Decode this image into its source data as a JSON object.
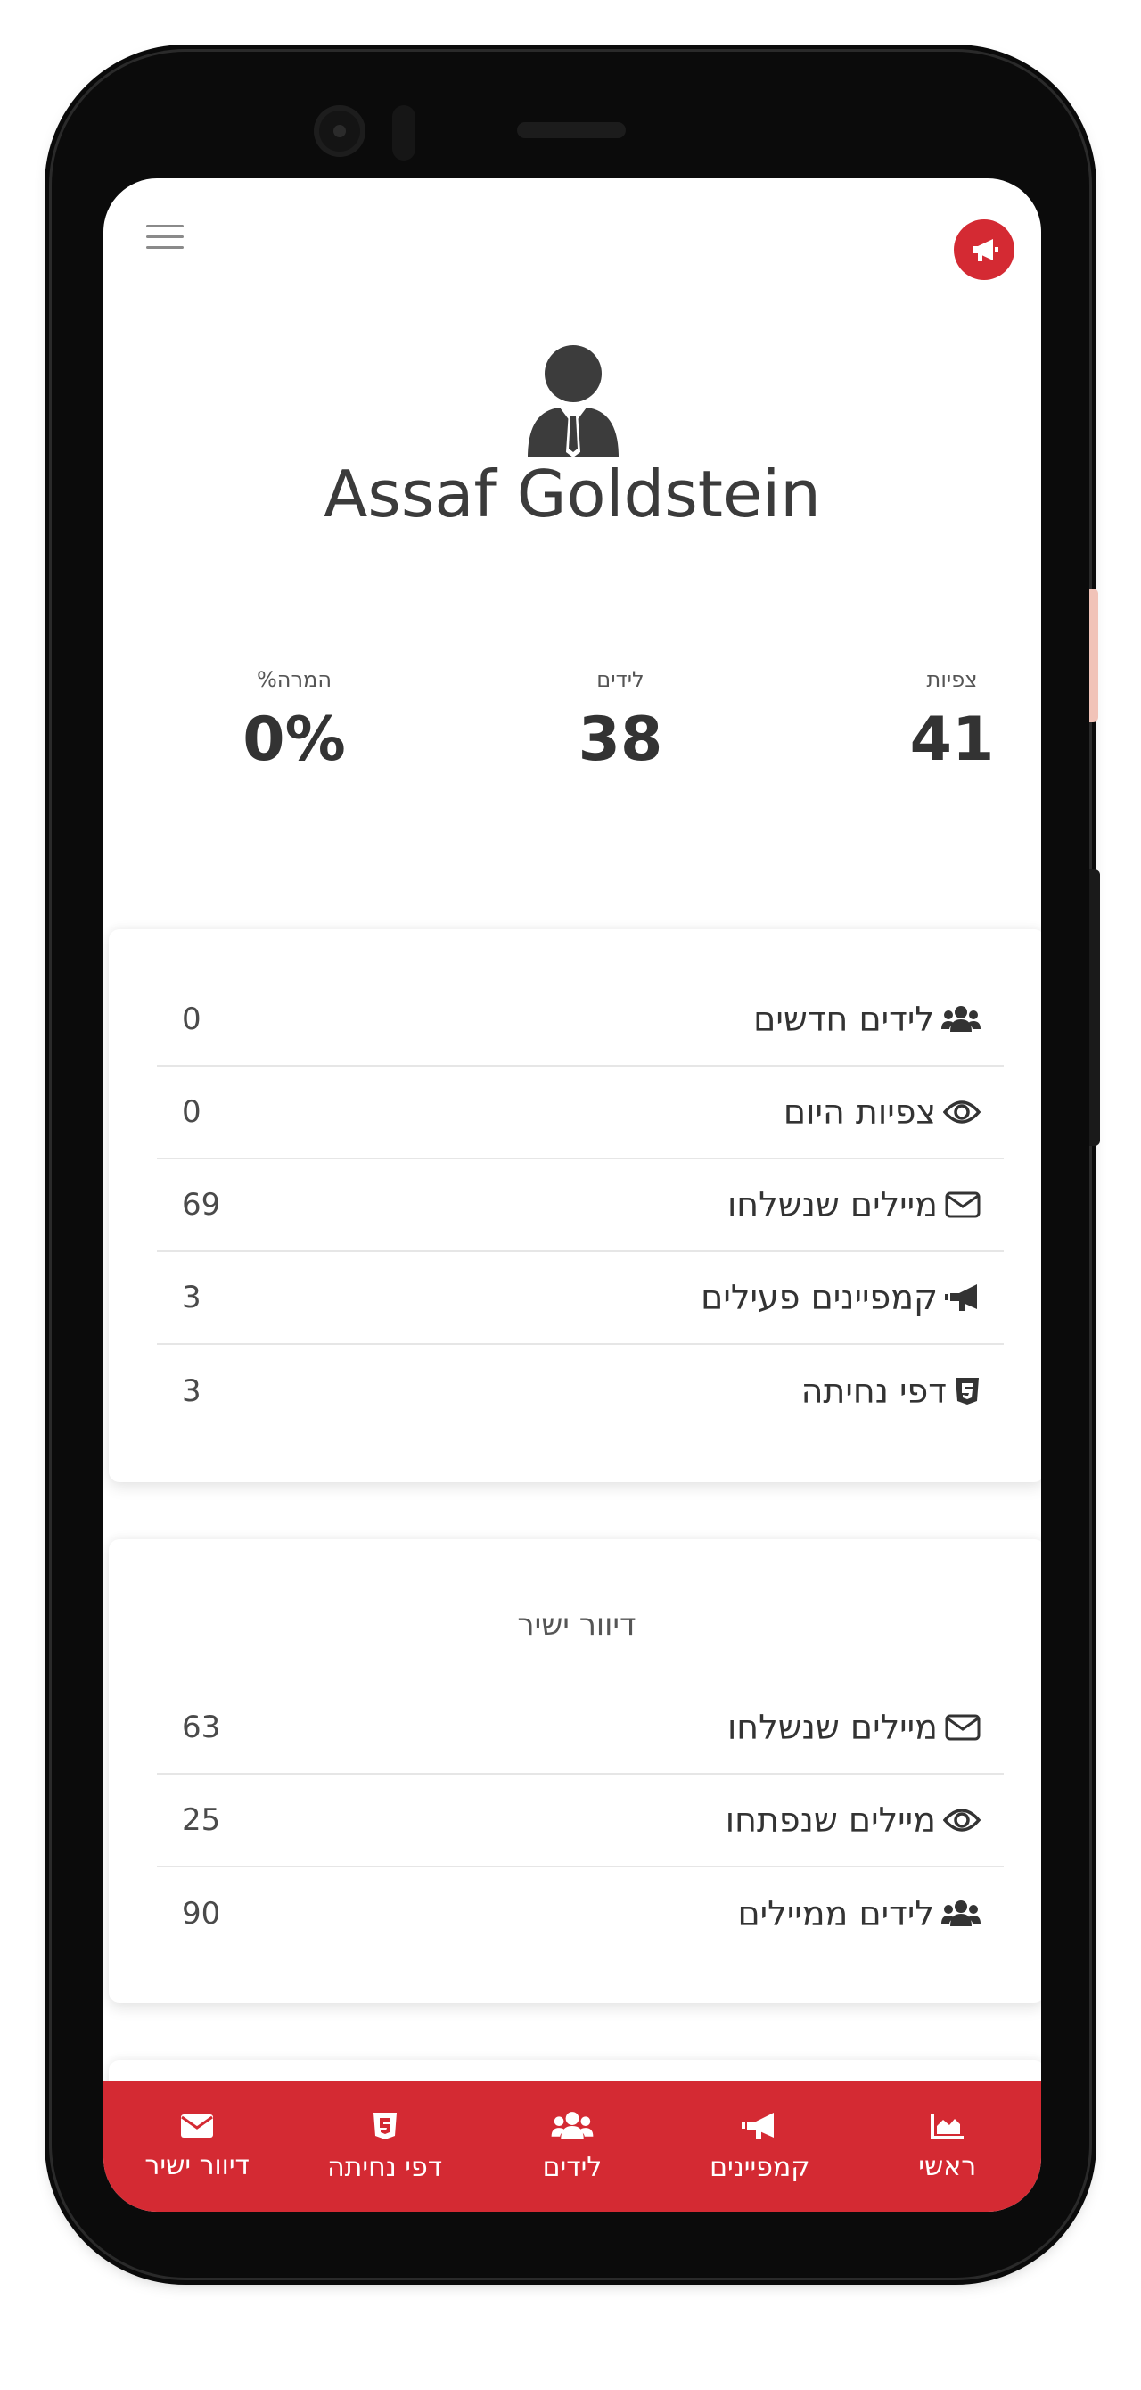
{
  "header": {
    "menu_icon": "hamburger-icon",
    "notify_icon": "bullhorn-icon"
  },
  "profile": {
    "icon": "user-tie-icon",
    "name": "Assaf Goldstein"
  },
  "stats": [
    {
      "label": "צפיות",
      "value": "41"
    },
    {
      "label": "לידים",
      "value": "38"
    },
    {
      "label": "המרה%",
      "value": "0%"
    }
  ],
  "summary": {
    "rows": [
      {
        "icon": "users-icon",
        "label": "לידים חדשים",
        "value": "0"
      },
      {
        "icon": "eye-icon",
        "label": "צפיות היום",
        "value": "0"
      },
      {
        "icon": "envelope-icon",
        "label": "מיילים שנשלחו",
        "value": "69"
      },
      {
        "icon": "bullhorn-icon",
        "label": "קמפיינים פעילים",
        "value": "3"
      },
      {
        "icon": "html5-icon",
        "label": "דפי נחיתה",
        "value": "3"
      }
    ]
  },
  "direct_mail": {
    "title": "דיוור ישיר",
    "rows": [
      {
        "icon": "envelope-icon",
        "label": "מיילים שנשלחו",
        "value": "63"
      },
      {
        "icon": "eye-icon",
        "label": "מיילים שנפתחו",
        "value": "25"
      },
      {
        "icon": "users-icon",
        "label": "לידים ממיילים",
        "value": "90"
      }
    ]
  },
  "bottom_nav": [
    {
      "icon": "chart-area-icon",
      "label": "ראשי"
    },
    {
      "icon": "bullhorn-icon",
      "label": "קמפיינים"
    },
    {
      "icon": "users-icon",
      "label": "לידים"
    },
    {
      "icon": "html5-icon",
      "label": "דפי נחיתה"
    },
    {
      "icon": "envelope-icon",
      "label": "דיוור ישיר"
    }
  ],
  "colors": {
    "accent": "#d42a33",
    "text_dark": "#333333",
    "divider": "#e6e6e6"
  }
}
